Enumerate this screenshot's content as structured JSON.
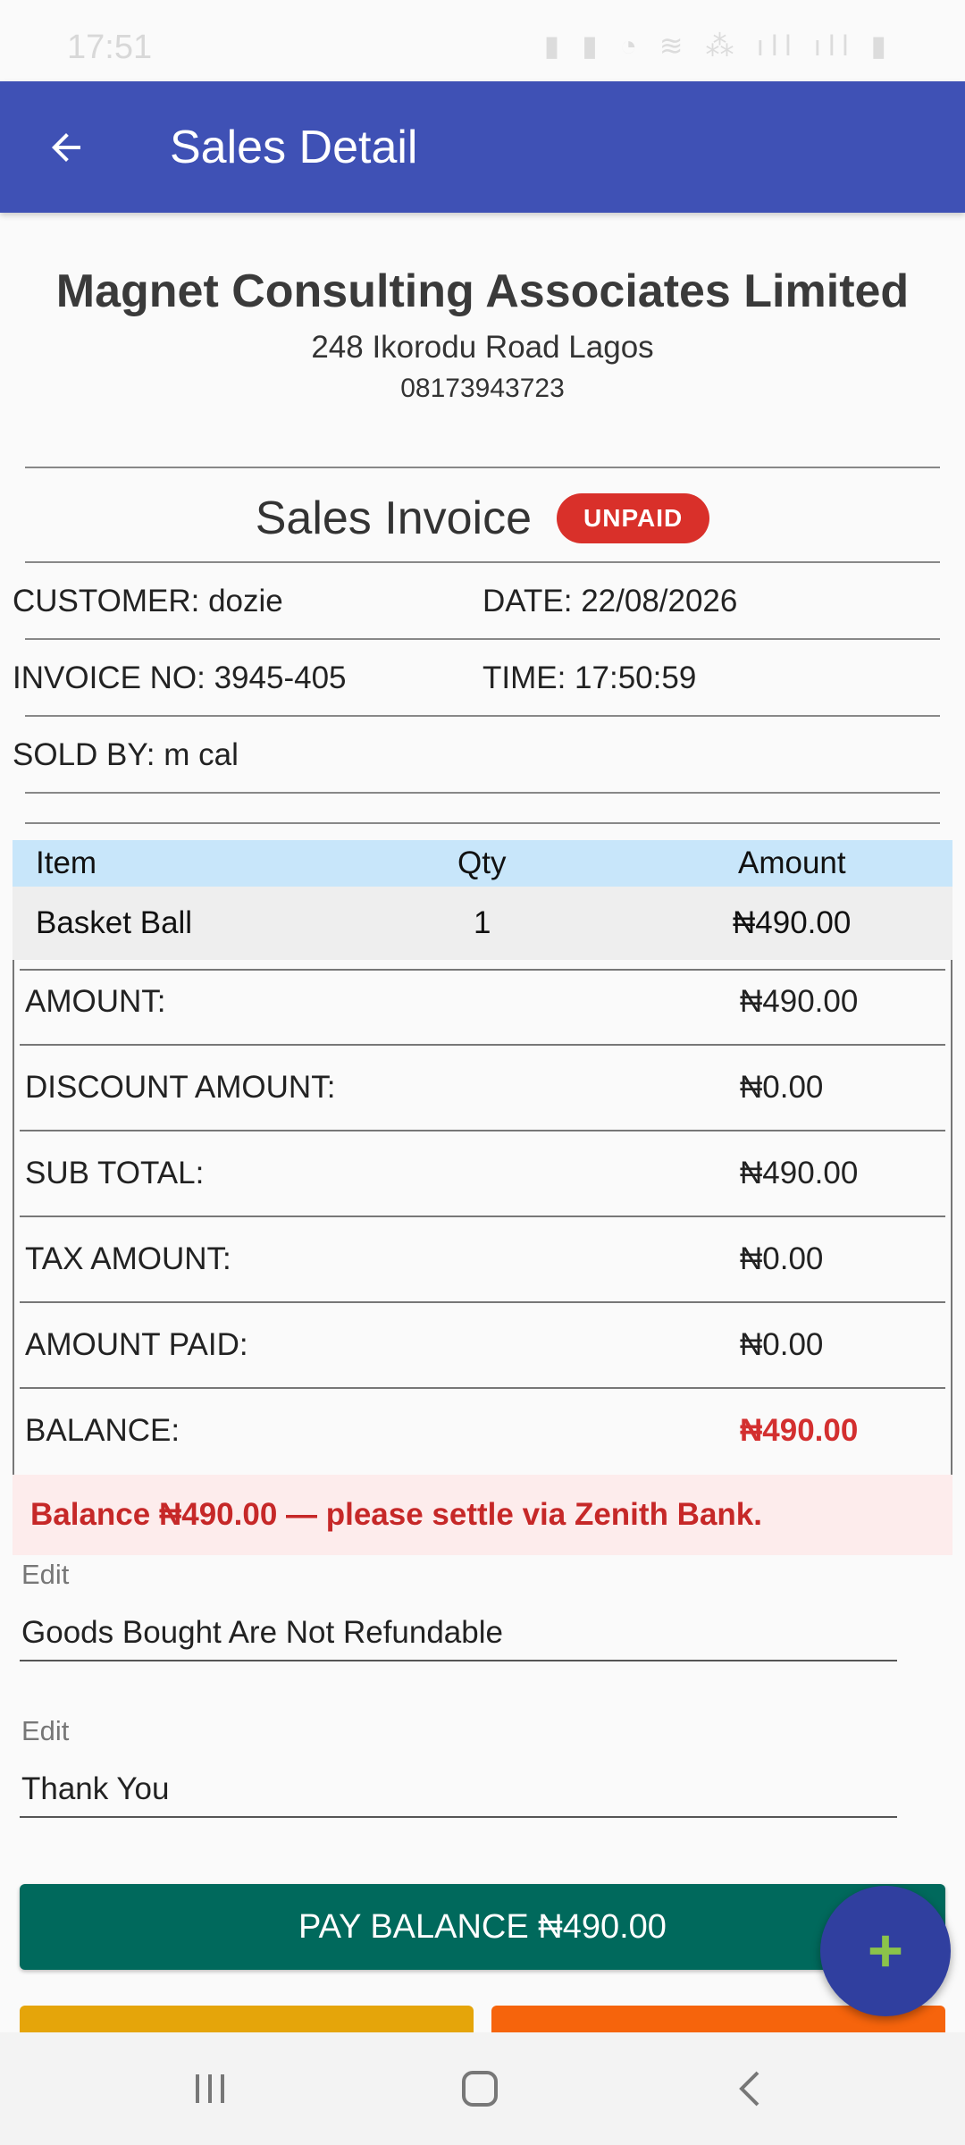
{
  "status_bar": {
    "time": "17:51",
    "icons_text": "▮ ▮ ◔ ≋ ⁂ ıll ıll ▮"
  },
  "app_bar": {
    "title": "Sales Detail"
  },
  "company": {
    "name": "Magnet Consulting Associates Limited",
    "address": "248 Ikorodu Road Lagos",
    "phone": "08173943723"
  },
  "invoice": {
    "title": "Sales Invoice",
    "status": "UNPAID"
  },
  "meta": {
    "customer": "CUSTOMER: dozie",
    "date": "DATE: 22/08/2026",
    "invoice_no": "INVOICE NO: 3945-405",
    "time": "TIME: 17:50:59",
    "sold_by": "SOLD BY: m cal"
  },
  "table": {
    "headers": {
      "item": "Item",
      "qty": "Qty",
      "amount": "Amount"
    },
    "rows": [
      {
        "item": "Basket Ball",
        "qty": "1",
        "amount": "₦490.00"
      }
    ]
  },
  "summary": {
    "amount_label": "AMOUNT:",
    "amount_value": "₦490.00",
    "discount_label": "DISCOUNT AMOUNT:",
    "discount_value": "₦0.00",
    "subtotal_label": "SUB TOTAL:",
    "subtotal_value": "₦490.00",
    "tax_label": "TAX AMOUNT:",
    "tax_value": "₦0.00",
    "paid_label": "AMOUNT PAID:",
    "paid_value": "₦0.00",
    "balance_label": "BALANCE:",
    "balance_value": "₦490.00"
  },
  "alert": {
    "text": "Balance ₦490.00 — please settle via Zenith Bank."
  },
  "fields": {
    "note1_label": "Edit",
    "note1_value": "Goods Bought Are Not Refundable",
    "note2_label": "Edit",
    "note2_value": "Thank You"
  },
  "actions": {
    "pay_label": "PAY BALANCE ₦490.00"
  },
  "colors": {
    "app_bar": "#3f51b5",
    "badge": "#d9302a",
    "pay_button": "#00695c",
    "fab": "#303f9f",
    "fab_icon": "#8bc34a",
    "alert_text": "#c62828"
  }
}
